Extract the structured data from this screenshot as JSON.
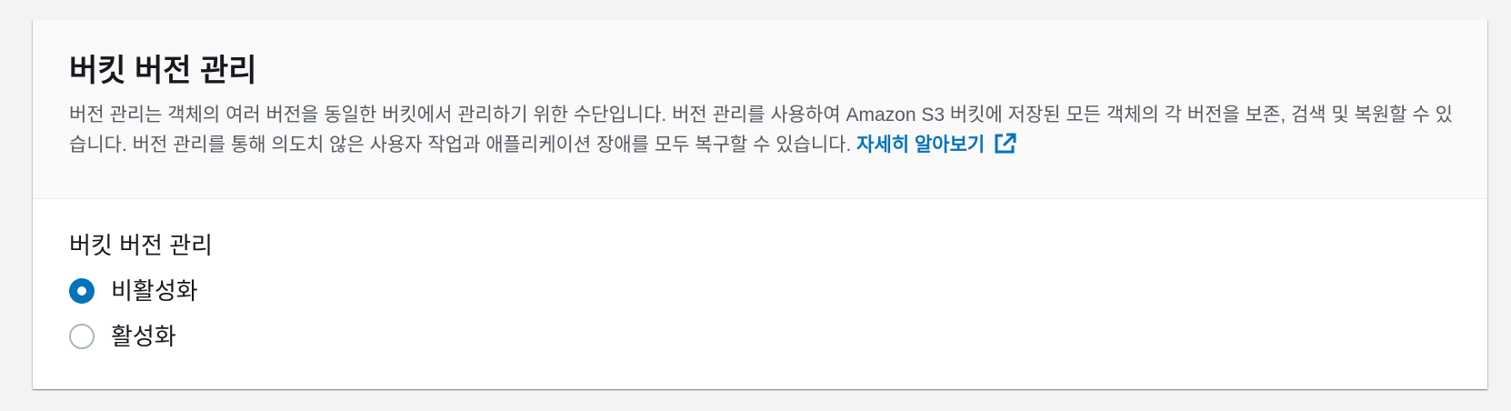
{
  "header": {
    "title": "버킷 버전 관리",
    "description": "버전 관리는 객체의 여러 버전을 동일한 버킷에서 관리하기 위한 수단입니다. 버전 관리를 사용하여 Amazon S3 버킷에 저장된 모든 객체의 각 버전을 보존, 검색 및 복원할 수 있습니다. 버전 관리를 통해 의도치 않은 사용자 작업과 애플리케이션 장애를 모두 복구할 수 있습니다. ",
    "learn_more_label": "자세히 알아보기",
    "learn_more_icon": "external-link-icon"
  },
  "versioning": {
    "label": "버킷 버전 관리",
    "options": [
      {
        "label": "비활성화",
        "selected": true
      },
      {
        "label": "활성화",
        "selected": false
      }
    ]
  },
  "colors": {
    "accent": "#0073bb",
    "text": "#16191f",
    "muted_text": "#545b64",
    "radio_border": "#aab7b8"
  }
}
